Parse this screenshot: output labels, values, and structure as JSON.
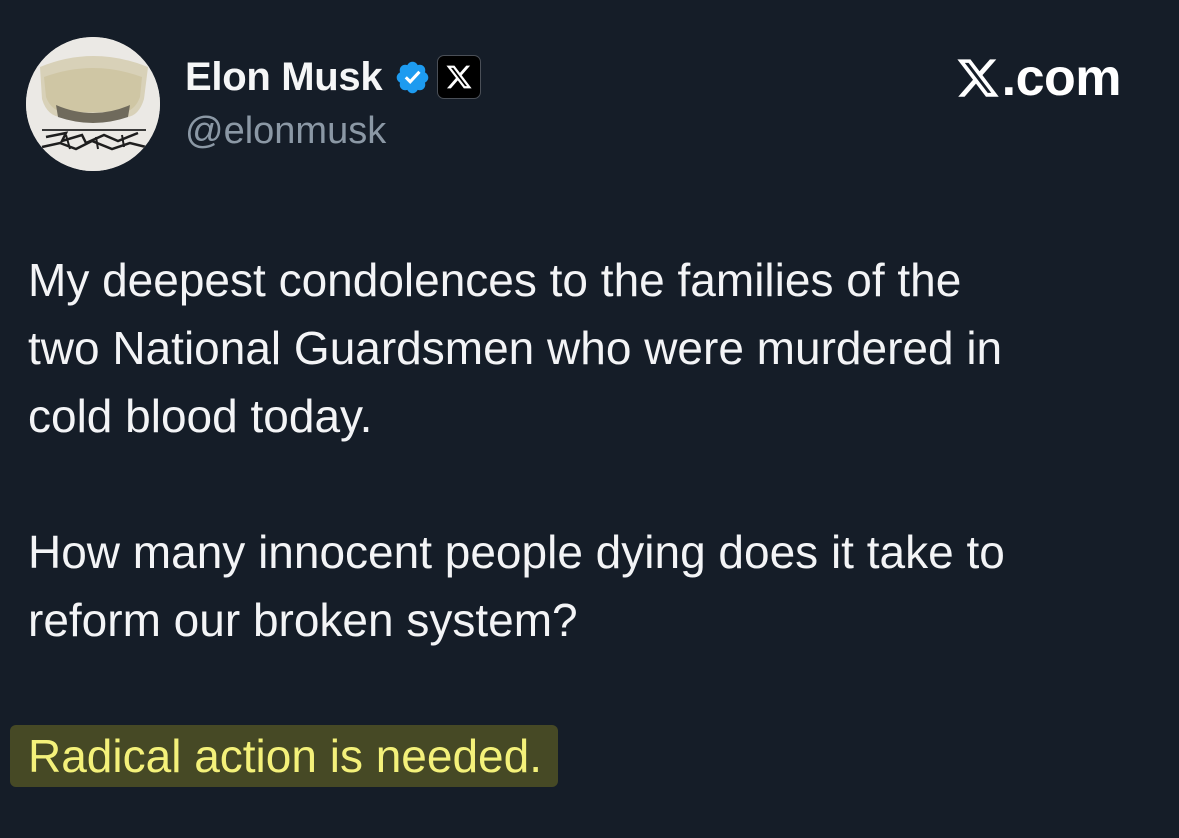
{
  "author": {
    "display_name": "Elon Musk",
    "handle": "@elonmusk",
    "avatar_icon": "sculpture-avatar-icon",
    "verified_icon": "verified-badge-icon",
    "affiliation_icon": "x-logo-icon",
    "verified_color": "#1d9bf0"
  },
  "brand": {
    "text": ".com",
    "icon": "x-logo-icon"
  },
  "tweet": {
    "line_1": "My deepest condolences to the families of the",
    "line_2": "two National Guardsmen who were murdered in",
    "line_3": "cold blood today.",
    "line_4": "How many innocent people dying does it take to",
    "line_5": "reform our broken system?",
    "highlighted": "Radical action is needed."
  },
  "colors": {
    "background": "#151d28",
    "text": "#f3f4f6",
    "handle": "#8b98a5",
    "highlight_text": "#f4f17a",
    "highlight_bg": "#5c5b26"
  }
}
